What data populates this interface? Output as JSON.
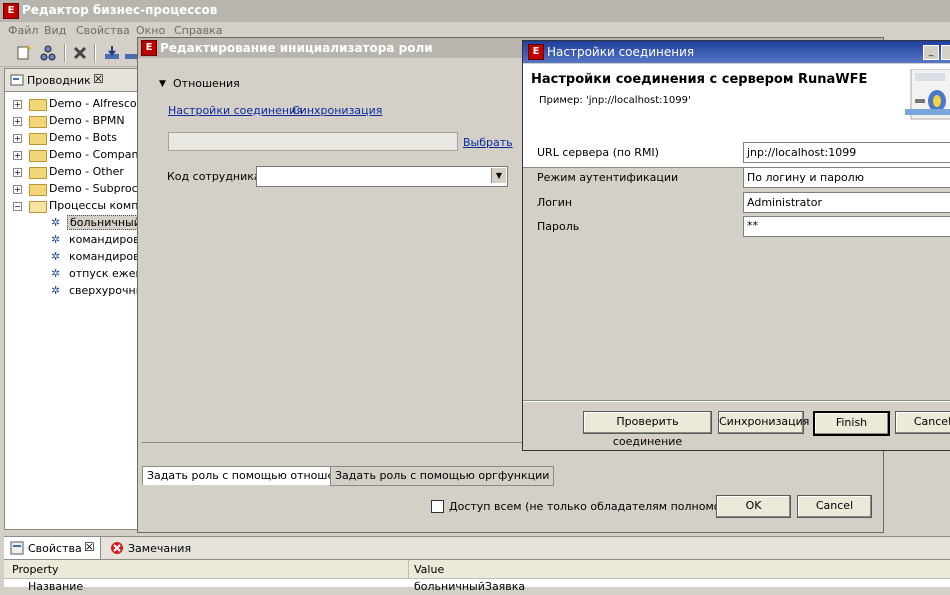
{
  "main_window": {
    "title": "Редактор бизнес-процессов",
    "menu": [
      "Файл",
      "Вид",
      "Свойства",
      "Окно",
      "Справка"
    ]
  },
  "explorer": {
    "tab_label": "Проводник",
    "close": "☒",
    "tree": [
      {
        "label": "Demo - Alfresco",
        "type": "folder",
        "expander": "+"
      },
      {
        "label": "Demo - BPMN",
        "type": "folder",
        "expander": "+"
      },
      {
        "label": "Demo - Bots",
        "type": "folder",
        "expander": "+"
      },
      {
        "label": "Demo - Company",
        "type": "folder",
        "expander": "+"
      },
      {
        "label": "Demo - Other",
        "type": "folder",
        "expander": "+"
      },
      {
        "label": "Demo - Subproces",
        "type": "folder",
        "expander": "+"
      },
      {
        "label": "Процессы компан",
        "type": "folder",
        "expander": "−"
      },
      {
        "label": "больничный",
        "type": "process",
        "selected": true
      },
      {
        "label": "командировк",
        "type": "process"
      },
      {
        "label": "командировк",
        "type": "process"
      },
      {
        "label": "отпуск ежегод",
        "type": "process"
      },
      {
        "label": "сверхурочны",
        "type": "process"
      }
    ]
  },
  "role_dialog": {
    "title": "Редактирование инициализатора роли",
    "section": "Отношения",
    "link_connection_settings": "Настройки соединения",
    "link_sync": "Синхронизация",
    "choose_link": "Выбрать",
    "employee_code_label": "Код сотрудника",
    "employee_code_value": "",
    "tabs": [
      "Задать роль с помощью отношения",
      "Задать роль с помощью оргфункции"
    ],
    "access_all_label": "Доступ всем (не только обладателям полномочий)",
    "ok": "OK",
    "cancel": "Cancel"
  },
  "connection_dialog": {
    "title": "Настройки соединения",
    "header_title": "Настройки соединения с сервером RunaWFE",
    "header_example": "Пример: 'jnp://localhost:1099'",
    "fields": [
      {
        "label": "URL сервера (по RMI)",
        "value": "jnp://localhost:1099"
      },
      {
        "label": "Режим аутентификации",
        "value": "По логину и паролю"
      },
      {
        "label": "Логин",
        "value": "Administrator"
      },
      {
        "label": "Пароль",
        "value": "**"
      }
    ],
    "buttons": [
      "Проверить соединение",
      "Синхронизация",
      "Finish",
      "Cancel"
    ]
  },
  "bottom_panel": {
    "tabs": [
      "Свойства",
      "Замечания"
    ],
    "columns": [
      "Property",
      "Value"
    ],
    "row": {
      "property": "Название",
      "value": "больничныйЗаявка"
    }
  },
  "colors": {
    "title_active": "#1e3f9c",
    "link": "#0a2a9e",
    "selection": "#d4d0c8"
  }
}
